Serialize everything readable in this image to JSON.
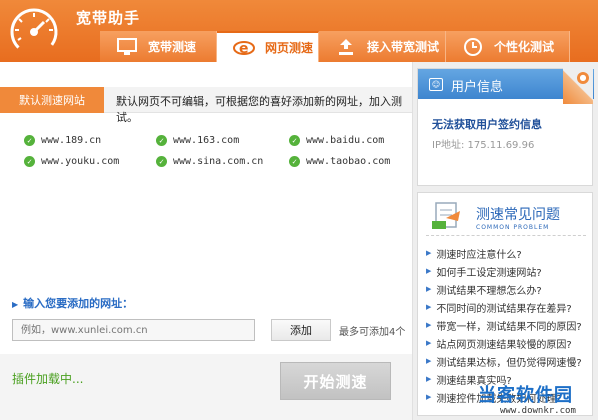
{
  "app": {
    "title": "宽带助手"
  },
  "tabs": [
    {
      "label": "宽带测速",
      "icon": "monitor-icon"
    },
    {
      "label": "网页测速",
      "icon": "browser-icon"
    },
    {
      "label": "接入带宽测试",
      "icon": "upload-icon"
    },
    {
      "label": "个性化测试",
      "icon": "clock-icon"
    }
  ],
  "default_sites": {
    "tab_label": "默认测速网站",
    "notice": "默认网页不可编辑，可根据您的喜好添加新的网址，加入测试。",
    "sites": [
      "www.189.cn",
      "www.163.com",
      "www.baidu.com",
      "www.youku.com",
      "www.sina.com.cn",
      "www.taobao.com"
    ]
  },
  "add_site": {
    "label": "输入您要添加的网址：",
    "placeholder": "例如，www.xunlei.com.cn",
    "button": "添加",
    "max_note": "最多可添加4个"
  },
  "status": {
    "loading": "插件加载中...",
    "start_button": "开始测速"
  },
  "user_info": {
    "title": "用户信息",
    "message": "无法获取用户签约信息",
    "ip": "IP地址: 175.11.69.96"
  },
  "faq": {
    "title": "测速常见问题",
    "subtitle": "COMMON PROBLEM",
    "items": [
      "测速时应注意什么?",
      "如何手工设定测速网站?",
      "测试结果不理想怎么办?",
      "不同时间的测试结果存在差异?",
      "带宽一样，测试结果不同的原因?",
      "站点网页测速结果较慢的原因?",
      "测试结果达标，但仍觉得网速慢?",
      "测速结果真实吗?",
      "测速控件加载失败如何处理?"
    ]
  },
  "watermark": {
    "text": "当客软件园",
    "url": "www.downkr.com"
  },
  "colors": {
    "accent": "#e86d1f",
    "link": "#2a67b8",
    "ok": "#55b23b"
  }
}
